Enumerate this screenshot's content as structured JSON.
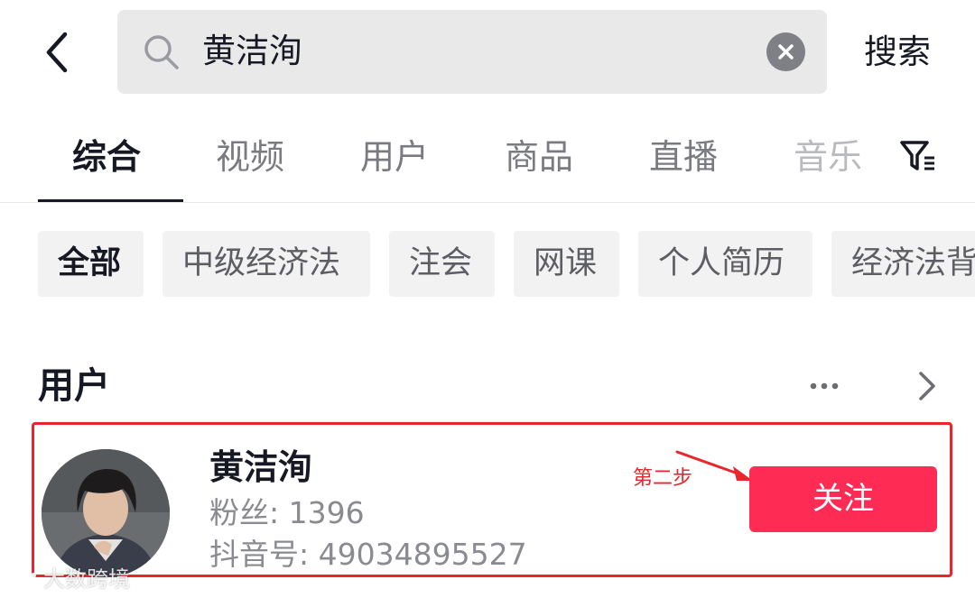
{
  "search": {
    "query": "黄洁洵",
    "submit_label": "搜索"
  },
  "tabs": [
    {
      "label": "综合",
      "active": true
    },
    {
      "label": "视频"
    },
    {
      "label": "用户"
    },
    {
      "label": "商品"
    },
    {
      "label": "直播"
    },
    {
      "label": "音乐"
    }
  ],
  "chips": [
    {
      "label": "全部",
      "active": true
    },
    {
      "label": "中级经济法"
    },
    {
      "label": "注会"
    },
    {
      "label": "网课"
    },
    {
      "label": "个人简历"
    },
    {
      "label": "经济法背"
    }
  ],
  "users_section": {
    "title": "用户"
  },
  "user_result": {
    "name": "黄洁洵",
    "fans": "粉丝: 1396",
    "douyin_id": "抖音号: 49034895527",
    "follow_label": "关注"
  },
  "annotation": {
    "step_label": "第二步",
    "color": "#e8262c"
  },
  "watermark": {
    "text": "大数跨境"
  },
  "colors": {
    "accent": "#fe2c55",
    "highlight": "#e8262c"
  },
  "icons": [
    "back-arrow-icon",
    "search-icon",
    "clear-icon",
    "filter-icon",
    "more-dots-icon",
    "chevron-right-icon"
  ]
}
